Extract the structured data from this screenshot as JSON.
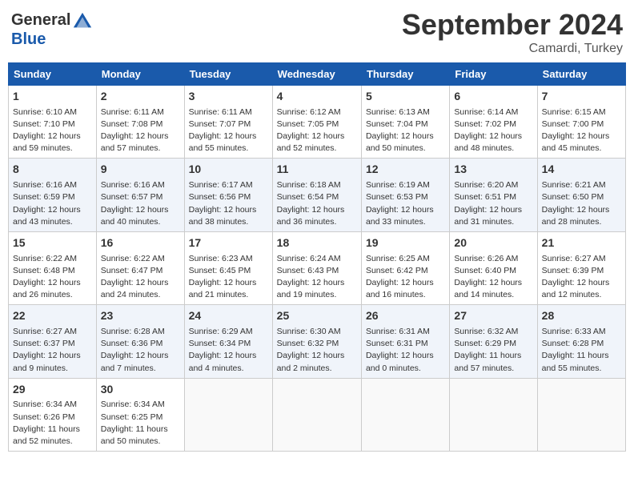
{
  "header": {
    "logo_general": "General",
    "logo_blue": "Blue",
    "month_title": "September 2024",
    "location": "Camardi, Turkey"
  },
  "weekdays": [
    "Sunday",
    "Monday",
    "Tuesday",
    "Wednesday",
    "Thursday",
    "Friday",
    "Saturday"
  ],
  "weeks": [
    [
      {
        "day": "1",
        "info": "Sunrise: 6:10 AM\nSunset: 7:10 PM\nDaylight: 12 hours\nand 59 minutes."
      },
      {
        "day": "2",
        "info": "Sunrise: 6:11 AM\nSunset: 7:08 PM\nDaylight: 12 hours\nand 57 minutes."
      },
      {
        "day": "3",
        "info": "Sunrise: 6:11 AM\nSunset: 7:07 PM\nDaylight: 12 hours\nand 55 minutes."
      },
      {
        "day": "4",
        "info": "Sunrise: 6:12 AM\nSunset: 7:05 PM\nDaylight: 12 hours\nand 52 minutes."
      },
      {
        "day": "5",
        "info": "Sunrise: 6:13 AM\nSunset: 7:04 PM\nDaylight: 12 hours\nand 50 minutes."
      },
      {
        "day": "6",
        "info": "Sunrise: 6:14 AM\nSunset: 7:02 PM\nDaylight: 12 hours\nand 48 minutes."
      },
      {
        "day": "7",
        "info": "Sunrise: 6:15 AM\nSunset: 7:00 PM\nDaylight: 12 hours\nand 45 minutes."
      }
    ],
    [
      {
        "day": "8",
        "info": "Sunrise: 6:16 AM\nSunset: 6:59 PM\nDaylight: 12 hours\nand 43 minutes."
      },
      {
        "day": "9",
        "info": "Sunrise: 6:16 AM\nSunset: 6:57 PM\nDaylight: 12 hours\nand 40 minutes."
      },
      {
        "day": "10",
        "info": "Sunrise: 6:17 AM\nSunset: 6:56 PM\nDaylight: 12 hours\nand 38 minutes."
      },
      {
        "day": "11",
        "info": "Sunrise: 6:18 AM\nSunset: 6:54 PM\nDaylight: 12 hours\nand 36 minutes."
      },
      {
        "day": "12",
        "info": "Sunrise: 6:19 AM\nSunset: 6:53 PM\nDaylight: 12 hours\nand 33 minutes."
      },
      {
        "day": "13",
        "info": "Sunrise: 6:20 AM\nSunset: 6:51 PM\nDaylight: 12 hours\nand 31 minutes."
      },
      {
        "day": "14",
        "info": "Sunrise: 6:21 AM\nSunset: 6:50 PM\nDaylight: 12 hours\nand 28 minutes."
      }
    ],
    [
      {
        "day": "15",
        "info": "Sunrise: 6:22 AM\nSunset: 6:48 PM\nDaylight: 12 hours\nand 26 minutes."
      },
      {
        "day": "16",
        "info": "Sunrise: 6:22 AM\nSunset: 6:47 PM\nDaylight: 12 hours\nand 24 minutes."
      },
      {
        "day": "17",
        "info": "Sunrise: 6:23 AM\nSunset: 6:45 PM\nDaylight: 12 hours\nand 21 minutes."
      },
      {
        "day": "18",
        "info": "Sunrise: 6:24 AM\nSunset: 6:43 PM\nDaylight: 12 hours\nand 19 minutes."
      },
      {
        "day": "19",
        "info": "Sunrise: 6:25 AM\nSunset: 6:42 PM\nDaylight: 12 hours\nand 16 minutes."
      },
      {
        "day": "20",
        "info": "Sunrise: 6:26 AM\nSunset: 6:40 PM\nDaylight: 12 hours\nand 14 minutes."
      },
      {
        "day": "21",
        "info": "Sunrise: 6:27 AM\nSunset: 6:39 PM\nDaylight: 12 hours\nand 12 minutes."
      }
    ],
    [
      {
        "day": "22",
        "info": "Sunrise: 6:27 AM\nSunset: 6:37 PM\nDaylight: 12 hours\nand 9 minutes."
      },
      {
        "day": "23",
        "info": "Sunrise: 6:28 AM\nSunset: 6:36 PM\nDaylight: 12 hours\nand 7 minutes."
      },
      {
        "day": "24",
        "info": "Sunrise: 6:29 AM\nSunset: 6:34 PM\nDaylight: 12 hours\nand 4 minutes."
      },
      {
        "day": "25",
        "info": "Sunrise: 6:30 AM\nSunset: 6:32 PM\nDaylight: 12 hours\nand 2 minutes."
      },
      {
        "day": "26",
        "info": "Sunrise: 6:31 AM\nSunset: 6:31 PM\nDaylight: 12 hours\nand 0 minutes."
      },
      {
        "day": "27",
        "info": "Sunrise: 6:32 AM\nSunset: 6:29 PM\nDaylight: 11 hours\nand 57 minutes."
      },
      {
        "day": "28",
        "info": "Sunrise: 6:33 AM\nSunset: 6:28 PM\nDaylight: 11 hours\nand 55 minutes."
      }
    ],
    [
      {
        "day": "29",
        "info": "Sunrise: 6:34 AM\nSunset: 6:26 PM\nDaylight: 11 hours\nand 52 minutes."
      },
      {
        "day": "30",
        "info": "Sunrise: 6:34 AM\nSunset: 6:25 PM\nDaylight: 11 hours\nand 50 minutes."
      },
      {
        "day": "",
        "info": ""
      },
      {
        "day": "",
        "info": ""
      },
      {
        "day": "",
        "info": ""
      },
      {
        "day": "",
        "info": ""
      },
      {
        "day": "",
        "info": ""
      }
    ]
  ]
}
